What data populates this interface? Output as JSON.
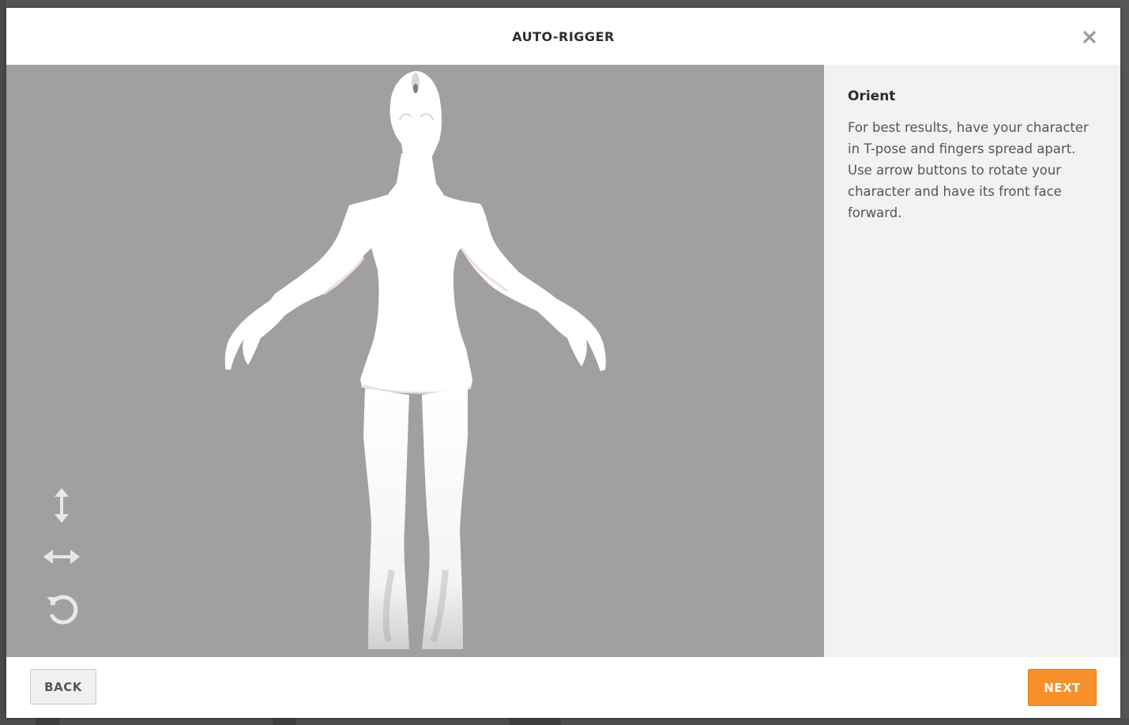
{
  "modal": {
    "title": "AUTO-RIGGER",
    "close_icon": "close-icon"
  },
  "viewport": {
    "background": "#a0a0a0",
    "controls": [
      {
        "name": "rotate-vertical-button",
        "icon": "vertical-arrows-icon"
      },
      {
        "name": "rotate-horizontal-button",
        "icon": "horizontal-arrows-icon"
      },
      {
        "name": "rotate-reset-button",
        "icon": "rotate-icon"
      }
    ]
  },
  "side_panel": {
    "title": "Orient",
    "description": "For best results, have your character in T-pose and fingers spread apart. Use arrow buttons to rotate your character and have its front face forward."
  },
  "footer": {
    "back_label": "BACK",
    "next_label": "NEXT",
    "next_color": "#f7902a"
  }
}
